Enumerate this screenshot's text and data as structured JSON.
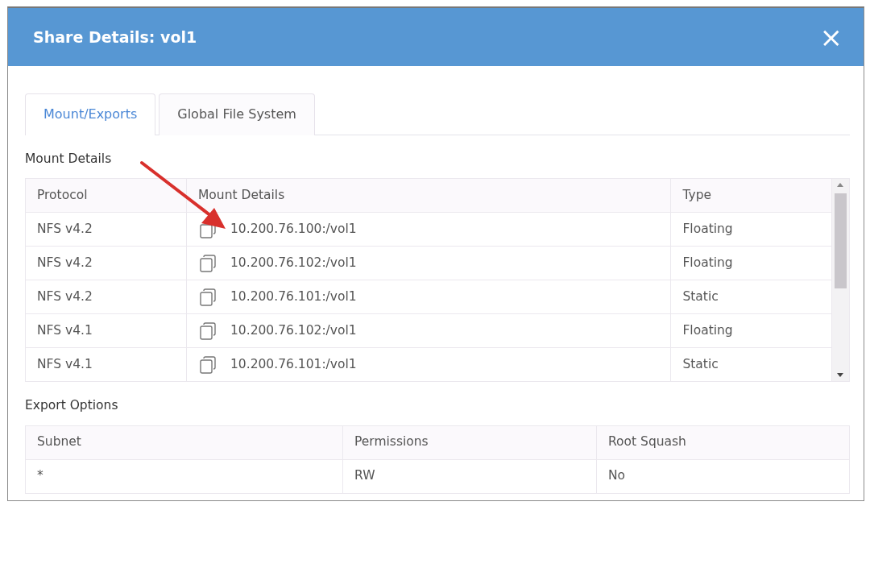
{
  "dialog": {
    "title": "Share Details: vol1",
    "close": "×"
  },
  "tabs": [
    {
      "label": "Mount/Exports",
      "selected": true
    },
    {
      "label": "Global File System",
      "selected": false
    }
  ],
  "mount_details": {
    "title": "Mount Details",
    "columns": [
      "Protocol",
      "Mount Details",
      "Type"
    ],
    "rows": [
      {
        "protocol": "NFS v4.2",
        "mount": "10.200.76.100:/vol1",
        "type": "Floating"
      },
      {
        "protocol": "NFS v4.2",
        "mount": "10.200.76.102:/vol1",
        "type": "Floating"
      },
      {
        "protocol": "NFS v4.2",
        "mount": "10.200.76.101:/vol1",
        "type": "Static"
      },
      {
        "protocol": "NFS v4.1",
        "mount": "10.200.76.102:/vol1",
        "type": "Floating"
      },
      {
        "protocol": "NFS v4.1",
        "mount": "10.200.76.101:/vol1",
        "type": "Static"
      }
    ]
  },
  "export_options": {
    "title": "Export Options",
    "columns": [
      "Subnet",
      "Permissions",
      "Root Squash"
    ],
    "rows": [
      [
        "*",
        "RW",
        "No"
      ]
    ]
  }
}
